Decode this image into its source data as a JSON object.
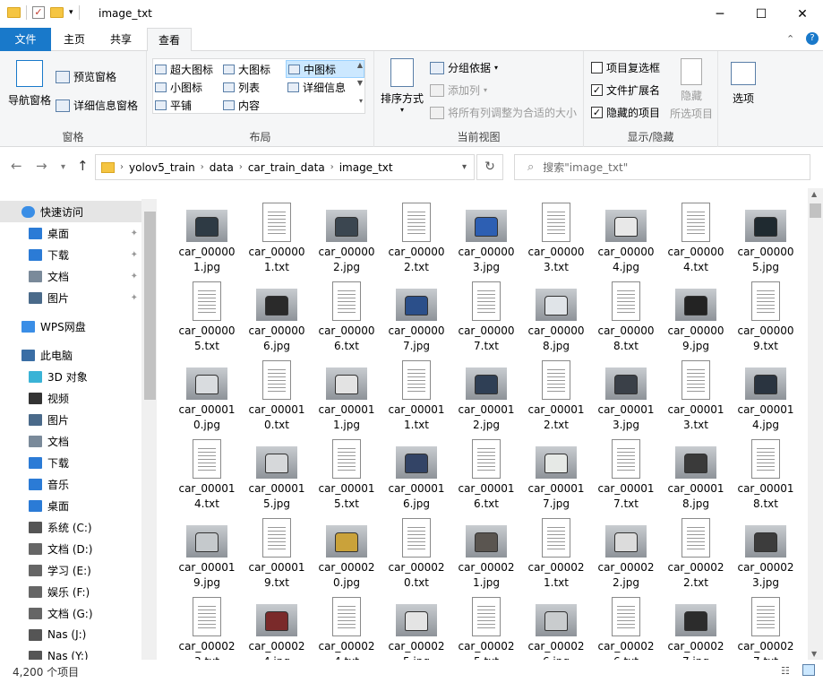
{
  "window": {
    "title": "image_txt",
    "minimize": "─",
    "maximize": "☐",
    "close": "✕"
  },
  "tabs": [
    {
      "label": "文件"
    },
    {
      "label": "主页"
    },
    {
      "label": "共享"
    },
    {
      "label": "查看"
    }
  ],
  "ribbon": {
    "panes": {
      "label": "窗格",
      "nav_pane": "导航窗格",
      "preview_pane": "预览窗格",
      "details_pane": "详细信息窗格"
    },
    "layout": {
      "label": "布局",
      "items": [
        "超大图标",
        "大图标",
        "中图标",
        "小图标",
        "列表",
        "详细信息",
        "平铺",
        "内容"
      ],
      "selected": "中图标"
    },
    "current_view": {
      "label": "当前视图",
      "sort_by": "排序方式",
      "group_by": "分组依据",
      "add_column": "添加列",
      "size_columns": "将所有列调整为合适的大小"
    },
    "show_hide": {
      "label": "显示/隐藏",
      "item_checkboxes": {
        "label": "项目复选框",
        "checked": false
      },
      "file_extensions": {
        "label": "文件扩展名",
        "checked": true
      },
      "hidden_items": {
        "label": "隐藏的项目",
        "checked": true
      },
      "hide_selected": "隐藏",
      "hide_selected_2": "所选项目"
    },
    "options": "选项"
  },
  "address": {
    "crumbs": [
      "yolov5_train",
      "data",
      "car_train_data",
      "image_txt"
    ],
    "search_placeholder": "搜索\"image_txt\""
  },
  "sidebar": {
    "items": [
      {
        "label": "快速访问",
        "icon": "star-icon",
        "pinned": false
      },
      {
        "label": "桌面",
        "icon": "desktop-icon",
        "pinned": true
      },
      {
        "label": "下载",
        "icon": "download-icon",
        "pinned": true
      },
      {
        "label": "文档",
        "icon": "document-icon",
        "pinned": true
      },
      {
        "label": "图片",
        "icon": "picture-icon",
        "pinned": true
      },
      {
        "label": "WPS网盘",
        "icon": "cloud-icon",
        "pinned": false
      },
      {
        "label": "此电脑",
        "icon": "computer-icon",
        "pinned": false
      },
      {
        "label": "3D 对象",
        "icon": "3d-objects-icon",
        "pinned": false
      },
      {
        "label": "视频",
        "icon": "video-icon",
        "pinned": false
      },
      {
        "label": "图片",
        "icon": "picture-icon",
        "pinned": false
      },
      {
        "label": "文档",
        "icon": "document-icon",
        "pinned": false
      },
      {
        "label": "下载",
        "icon": "download-icon",
        "pinned": false
      },
      {
        "label": "音乐",
        "icon": "music-icon",
        "pinned": false
      },
      {
        "label": "桌面",
        "icon": "desktop-icon",
        "pinned": false
      },
      {
        "label": "系统 (C:)",
        "icon": "system-drive-icon",
        "pinned": false
      },
      {
        "label": "文档 (D:)",
        "icon": "drive-icon",
        "pinned": false
      },
      {
        "label": "学习 (E:)",
        "icon": "drive-icon",
        "pinned": false
      },
      {
        "label": "娱乐 (F:)",
        "icon": "drive-icon",
        "pinned": false
      },
      {
        "label": "文档 (G:)",
        "icon": "drive-icon",
        "pinned": false
      },
      {
        "label": "Nas (J:)",
        "icon": "network-drive-icon",
        "pinned": false
      },
      {
        "label": "Nas (Y:)",
        "icon": "network-drive-icon",
        "pinned": false
      }
    ]
  },
  "files": [
    {
      "l1": "car_00000",
      "l2": "1.jpg",
      "type": "jpg",
      "car": "#2e3a44"
    },
    {
      "l1": "car_00000",
      "l2": "1.txt",
      "type": "txt"
    },
    {
      "l1": "car_00000",
      "l2": "2.jpg",
      "type": "jpg",
      "car": "#3b4650"
    },
    {
      "l1": "car_00000",
      "l2": "2.txt",
      "type": "txt"
    },
    {
      "l1": "car_00000",
      "l2": "3.jpg",
      "type": "jpg",
      "car": "#2d5fb3"
    },
    {
      "l1": "car_00000",
      "l2": "3.txt",
      "type": "txt"
    },
    {
      "l1": "car_00000",
      "l2": "4.jpg",
      "type": "jpg",
      "car": "#e8e8e8"
    },
    {
      "l1": "car_00000",
      "l2": "4.txt",
      "type": "txt"
    },
    {
      "l1": "car_00000",
      "l2": "5.jpg",
      "type": "jpg",
      "car": "#1f2a30"
    },
    {
      "l1": "car_00000",
      "l2": "5.txt",
      "type": "txt"
    },
    {
      "l1": "car_00000",
      "l2": "6.jpg",
      "type": "jpg",
      "car": "#2a2a2a"
    },
    {
      "l1": "car_00000",
      "l2": "6.txt",
      "type": "txt"
    },
    {
      "l1": "car_00000",
      "l2": "7.jpg",
      "type": "jpg",
      "car": "#2b4f8a"
    },
    {
      "l1": "car_00000",
      "l2": "7.txt",
      "type": "txt"
    },
    {
      "l1": "car_00000",
      "l2": "8.jpg",
      "type": "jpg",
      "car": "#e0e4e8"
    },
    {
      "l1": "car_00000",
      "l2": "8.txt",
      "type": "txt"
    },
    {
      "l1": "car_00000",
      "l2": "9.jpg",
      "type": "jpg",
      "car": "#232323"
    },
    {
      "l1": "car_00000",
      "l2": "9.txt",
      "type": "txt"
    },
    {
      "l1": "car_00001",
      "l2": "0.jpg",
      "type": "jpg",
      "car": "#d9dcdf"
    },
    {
      "l1": "car_00001",
      "l2": "0.txt",
      "type": "txt"
    },
    {
      "l1": "car_00001",
      "l2": "1.jpg",
      "type": "jpg",
      "car": "#e3e3e3"
    },
    {
      "l1": "car_00001",
      "l2": "1.txt",
      "type": "txt"
    },
    {
      "l1": "car_00001",
      "l2": "2.jpg",
      "type": "jpg",
      "car": "#2f3f55"
    },
    {
      "l1": "car_00001",
      "l2": "2.txt",
      "type": "txt"
    },
    {
      "l1": "car_00001",
      "l2": "3.jpg",
      "type": "jpg",
      "car": "#3a4048"
    },
    {
      "l1": "car_00001",
      "l2": "3.txt",
      "type": "txt"
    },
    {
      "l1": "car_00001",
      "l2": "4.jpg",
      "type": "jpg",
      "car": "#2a3440"
    },
    {
      "l1": "car_00001",
      "l2": "4.txt",
      "type": "txt"
    },
    {
      "l1": "car_00001",
      "l2": "5.jpg",
      "type": "jpg",
      "car": "#d6d8da"
    },
    {
      "l1": "car_00001",
      "l2": "5.txt",
      "type": "txt"
    },
    {
      "l1": "car_00001",
      "l2": "6.jpg",
      "type": "jpg",
      "car": "#334466"
    },
    {
      "l1": "car_00001",
      "l2": "6.txt",
      "type": "txt"
    },
    {
      "l1": "car_00001",
      "l2": "7.jpg",
      "type": "jpg",
      "car": "#e6e9e6"
    },
    {
      "l1": "car_00001",
      "l2": "7.txt",
      "type": "txt"
    },
    {
      "l1": "car_00001",
      "l2": "8.jpg",
      "type": "jpg",
      "car": "#3a3a3a"
    },
    {
      "l1": "car_00001",
      "l2": "8.txt",
      "type": "txt"
    },
    {
      "l1": "car_00001",
      "l2": "9.jpg",
      "type": "jpg",
      "car": "#c5c9cc"
    },
    {
      "l1": "car_00001",
      "l2": "9.txt",
      "type": "txt"
    },
    {
      "l1": "car_00002",
      "l2": "0.jpg",
      "type": "jpg",
      "car": "#caa23a"
    },
    {
      "l1": "car_00002",
      "l2": "0.txt",
      "type": "txt"
    },
    {
      "l1": "car_00002",
      "l2": "1.jpg",
      "type": "jpg",
      "car": "#5a5550"
    },
    {
      "l1": "car_00002",
      "l2": "1.txt",
      "type": "txt"
    },
    {
      "l1": "car_00002",
      "l2": "2.jpg",
      "type": "jpg",
      "car": "#dcdcdc"
    },
    {
      "l1": "car_00002",
      "l2": "2.txt",
      "type": "txt"
    },
    {
      "l1": "car_00002",
      "l2": "3.jpg",
      "type": "jpg",
      "car": "#3c3c3c"
    },
    {
      "l1": "car_00002",
      "l2": "3.txt",
      "type": "txt"
    },
    {
      "l1": "car_00002",
      "l2": "4.jpg",
      "type": "jpg",
      "car": "#7a2a2a"
    },
    {
      "l1": "car_00002",
      "l2": "4.txt",
      "type": "txt"
    },
    {
      "l1": "car_00002",
      "l2": "5.jpg",
      "type": "jpg",
      "car": "#e4e4e4"
    },
    {
      "l1": "car_00002",
      "l2": "5.txt",
      "type": "txt"
    },
    {
      "l1": "car_00002",
      "l2": "6.jpg",
      "type": "jpg",
      "car": "#c9ccce"
    },
    {
      "l1": "car_00002",
      "l2": "6.txt",
      "type": "txt"
    },
    {
      "l1": "car_00002",
      "l2": "7.jpg",
      "type": "jpg",
      "car": "#2c2c2c"
    },
    {
      "l1": "car_00002",
      "l2": "7.txt",
      "type": "txt"
    }
  ],
  "status": {
    "count": "4,200 个项目"
  }
}
